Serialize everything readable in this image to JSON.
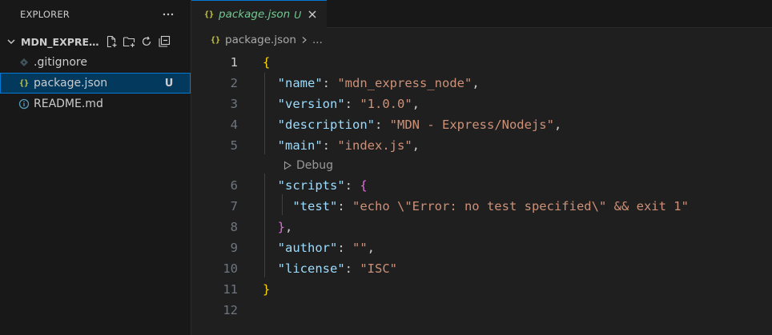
{
  "sidebar": {
    "title": "EXPLORER",
    "folder_name": "MDN_EXPRES...",
    "files": [
      {
        "name": ".gitignore",
        "badge": "",
        "icon": "gitignore-icon"
      },
      {
        "name": "package.json",
        "badge": "U",
        "icon": "json-icon"
      },
      {
        "name": "README.md",
        "badge": "",
        "icon": "info-icon"
      }
    ]
  },
  "tab": {
    "name": "package.json",
    "status": "U"
  },
  "breadcrumb": {
    "file": "package.json",
    "more": "..."
  },
  "editor": {
    "current_line": "1",
    "codelens_label": "Debug",
    "lines": [
      {
        "num": "1"
      },
      {
        "num": "2",
        "key": "\"name\"",
        "value": "\"mdn_express_node\""
      },
      {
        "num": "3",
        "key": "\"version\"",
        "value": "\"1.0.0\""
      },
      {
        "num": "4",
        "key": "\"description\"",
        "value": "\"MDN - Express/Nodejs\""
      },
      {
        "num": "5",
        "key": "\"main\"",
        "value": "\"index.js\""
      },
      {
        "num": "6",
        "key": "\"scripts\""
      },
      {
        "num": "7",
        "key": "\"test\"",
        "value": "\"echo \\\"Error: no test specified\\\" && exit 1\""
      },
      {
        "num": "8"
      },
      {
        "num": "9",
        "key": "\"author\"",
        "value": "\"\""
      },
      {
        "num": "10",
        "key": "\"license\"",
        "value": "\"ISC\""
      },
      {
        "num": "11"
      },
      {
        "num": "12"
      }
    ]
  },
  "colors": {
    "accent": "#0078d4",
    "untracked": "#73c991",
    "json_icon": "#cbcb41",
    "string": "#ce9178",
    "key": "#9cdcfe"
  }
}
